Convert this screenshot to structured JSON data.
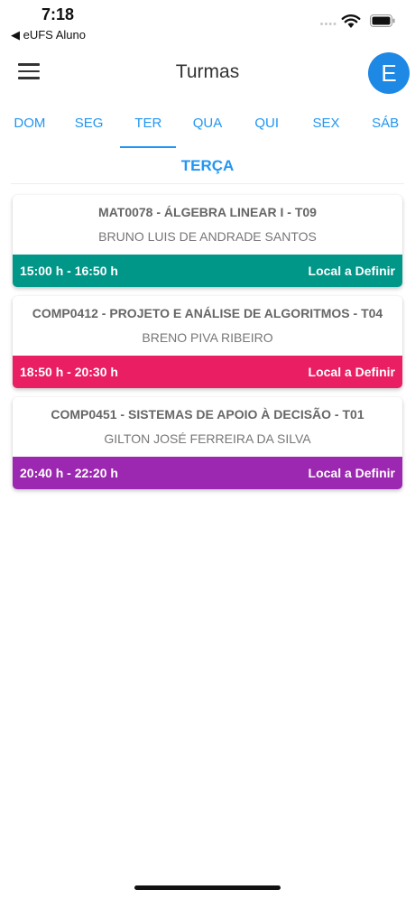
{
  "status_bar": {
    "time": "7:18",
    "back_app": "◀ eUFS Aluno",
    "signal": "••••"
  },
  "header": {
    "title": "Turmas",
    "avatar_letter": "E"
  },
  "tabs": [
    "DOM",
    "SEG",
    "TER",
    "QUA",
    "QUI",
    "SEX",
    "SÁB"
  ],
  "active_tab": "TER",
  "day_title": "TERÇA",
  "classes": [
    {
      "course": "MAT0078 - ÁLGEBRA LINEAR I - T09",
      "teacher": "BRUNO LUIS DE ANDRADE SANTOS",
      "time": "15:00 h - 16:50 h",
      "location": "Local a Definir",
      "color": "#009688"
    },
    {
      "course": "COMP0412 - PROJETO E ANÁLISE DE ALGORITMOS - T04",
      "teacher": "BRENO PIVA RIBEIRO",
      "time": "18:50 h - 20:30 h",
      "location": "Local a Definir",
      "color": "#e91e63"
    },
    {
      "course": "COMP0451 - SISTEMAS DE APOIO À DECISÃO - T01",
      "teacher": "GILTON JOSÉ FERREIRA DA SILVA",
      "time": "20:40 h - 22:20 h",
      "location": "Local a Definir",
      "color": "#9c27b0"
    }
  ],
  "colors": {
    "accent": "#2196f3",
    "avatar": "#1e88e5"
  },
  "icons": [
    "wifi-icon",
    "battery-icon",
    "menu-icon"
  ]
}
